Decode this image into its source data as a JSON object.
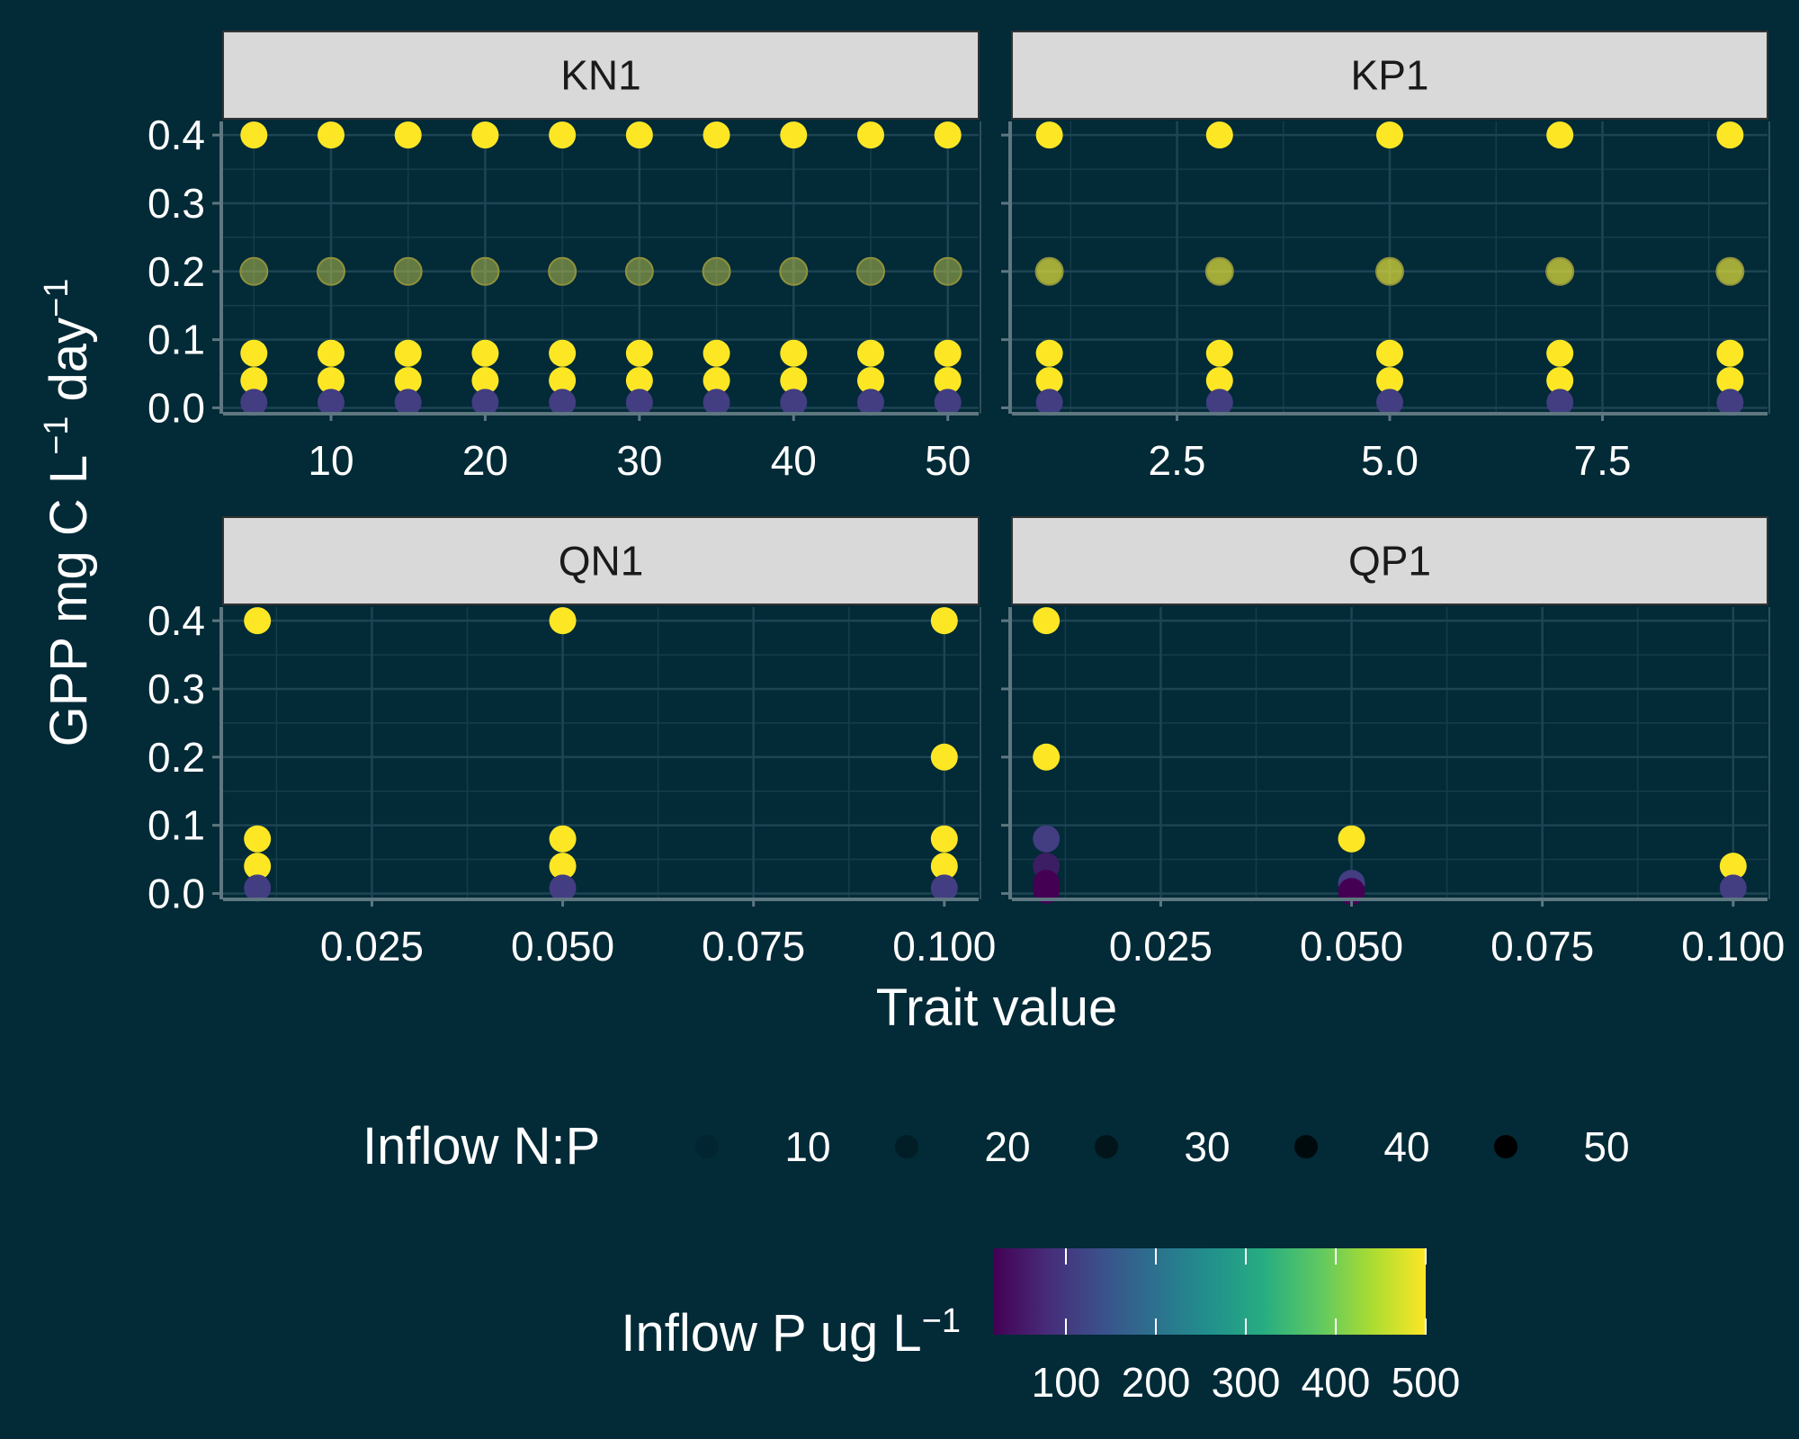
{
  "chart_data": {
    "type": "scatter",
    "xlabel": "Trait value",
    "ylabel_main": "GPP mg C L",
    "ylabel_mid": " day",
    "ylabel_sup": "−1",
    "y_ticks": [
      "0.0",
      "0.1",
      "0.2",
      "0.3",
      "0.4"
    ],
    "y_tick_values": [
      0.0,
      0.1,
      0.2,
      0.3,
      0.4
    ],
    "ylim": [
      -0.006,
      0.42
    ],
    "background": "#022a37",
    "strip_fill": "#d9d9d9",
    "text_color": "#ffffff",
    "panels": [
      {
        "title": "KN1",
        "xlim": [
          3.0,
          52.0
        ],
        "x_ticks": [
          "10",
          "20",
          "30",
          "40",
          "50"
        ],
        "x_tick_values": [
          10,
          20,
          30,
          40,
          50
        ],
        "x_minor": [
          5,
          15,
          25,
          35,
          45
        ],
        "points": [
          {
            "x": [
              5,
              10,
              15,
              20,
              25,
              30,
              35,
              40,
              45,
              50
            ],
            "y": 0.4,
            "color": "#fde725",
            "alpha": 1.0
          },
          {
            "x": [
              5,
              10,
              15,
              20,
              25,
              30,
              35,
              40,
              45,
              50
            ],
            "y": 0.2,
            "color": "#b5bd4c",
            "alpha": 0.55
          },
          {
            "x": [
              5,
              10,
              15,
              20,
              25,
              30,
              35,
              40,
              45,
              50
            ],
            "y": 0.08,
            "color": "#fde725",
            "alpha": 1.0
          },
          {
            "x": [
              5,
              10,
              15,
              20,
              25,
              30,
              35,
              40,
              45,
              50
            ],
            "y": 0.04,
            "color": "#fde725",
            "alpha": 1.0
          },
          {
            "x": [
              5,
              10,
              15,
              20,
              25,
              30,
              35,
              40,
              45,
              50
            ],
            "y": 0.008,
            "color": "#433d82",
            "alpha": 1.0
          }
        ]
      },
      {
        "title": "KP1",
        "xlim": [
          0.56,
          9.44
        ],
        "x_ticks": [
          "2.5",
          "5.0",
          "7.5"
        ],
        "x_tick_values": [
          2.5,
          5.0,
          7.5
        ],
        "x_minor": [
          1.25,
          3.75,
          6.25,
          8.75
        ],
        "points": [
          {
            "x": [
              1,
              3,
              5,
              7,
              9
            ],
            "y": 0.4,
            "color": "#fde725",
            "alpha": 1.0
          },
          {
            "x": [
              1,
              3,
              5,
              7,
              9
            ],
            "y": 0.2,
            "color": "#d9d83a",
            "alpha": 0.75
          },
          {
            "x": [
              1,
              3,
              5,
              7,
              9
            ],
            "y": 0.08,
            "color": "#fde725",
            "alpha": 1.0
          },
          {
            "x": [
              1,
              3,
              5,
              7,
              9
            ],
            "y": 0.04,
            "color": "#fde725",
            "alpha": 1.0
          },
          {
            "x": [
              1,
              3,
              5,
              7,
              9
            ],
            "y": 0.008,
            "color": "#433d82",
            "alpha": 1.0
          }
        ]
      },
      {
        "title": "QN1",
        "xlim": [
          0.0055,
          0.1045
        ],
        "x_ticks": [
          "0.025",
          "0.050",
          "0.075",
          "0.100"
        ],
        "x_tick_values": [
          0.025,
          0.05,
          0.075,
          0.1
        ],
        "x_minor": [
          0.0125,
          0.0375,
          0.0625,
          0.0875
        ],
        "points": [
          {
            "x": [
              0.01,
              0.05,
              0.1
            ],
            "y": 0.4,
            "color": "#fde725",
            "alpha": 1.0
          },
          {
            "x": [
              0.1
            ],
            "y": 0.2,
            "color": "#fde725",
            "alpha": 1.0
          },
          {
            "x": [
              0.01,
              0.05,
              0.1
            ],
            "y": 0.08,
            "color": "#fde725",
            "alpha": 1.0
          },
          {
            "x": [
              0.01,
              0.05,
              0.1
            ],
            "y": 0.04,
            "color": "#fde725",
            "alpha": 1.0
          },
          {
            "x": [
              0.01,
              0.05,
              0.1
            ],
            "y": 0.008,
            "color": "#433d82",
            "alpha": 1.0
          }
        ]
      },
      {
        "title": "QP1",
        "xlim": [
          0.0055,
          0.1045
        ],
        "x_ticks": [
          "0.025",
          "0.050",
          "0.075",
          "0.100"
        ],
        "x_tick_values": [
          0.025,
          0.05,
          0.075,
          0.1
        ],
        "x_minor": [
          0.0125,
          0.0375,
          0.0625,
          0.0875
        ],
        "points": [
          {
            "x": [
              0.01
            ],
            "y": 0.4,
            "color": "#fde725",
            "alpha": 1.0
          },
          {
            "x": [
              0.01
            ],
            "y": 0.2,
            "color": "#fde725",
            "alpha": 1.0
          },
          {
            "x": [
              0.01
            ],
            "y": 0.08,
            "color": "#433d82",
            "alpha": 1.0
          },
          {
            "x": [
              0.01
            ],
            "y": 0.04,
            "color": "#3b1e63",
            "alpha": 1.0
          },
          {
            "x": [
              0.01
            ],
            "y": 0.015,
            "color": "#440154",
            "alpha": 1.0
          },
          {
            "x": [
              0.01
            ],
            "y": 0.005,
            "color": "#440154",
            "alpha": 1.0
          },
          {
            "x": [
              0.05
            ],
            "y": 0.08,
            "color": "#fde725",
            "alpha": 1.0
          },
          {
            "x": [
              0.05
            ],
            "y": 0.015,
            "color": "#433d82",
            "alpha": 1.0
          },
          {
            "x": [
              0.05
            ],
            "y": 0.003,
            "color": "#440154",
            "alpha": 1.0
          },
          {
            "x": [
              0.1
            ],
            "y": 0.04,
            "color": "#fde725",
            "alpha": 1.0
          },
          {
            "x": [
              0.1
            ],
            "y": 0.008,
            "color": "#433d82",
            "alpha": 1.0
          }
        ]
      }
    ],
    "legend_size": {
      "title": "Inflow N:P",
      "labels": [
        "10",
        "20",
        "30",
        "40",
        "50"
      ],
      "alphas": [
        0.1,
        0.3,
        0.5,
        0.75,
        1.0
      ]
    },
    "legend_color": {
      "title_main": "Inflow P ug L",
      "title_sup": "−1",
      "labels": [
        "100",
        "200",
        "300",
        "400",
        "500"
      ],
      "tick_values": [
        100,
        200,
        300,
        400,
        500
      ],
      "range": [
        20,
        500
      ],
      "stops": [
        "#440154",
        "#472c7a",
        "#3b518b",
        "#2c718e",
        "#21908d",
        "#27ad81",
        "#5cc863",
        "#aadc32",
        "#fde725"
      ]
    }
  }
}
